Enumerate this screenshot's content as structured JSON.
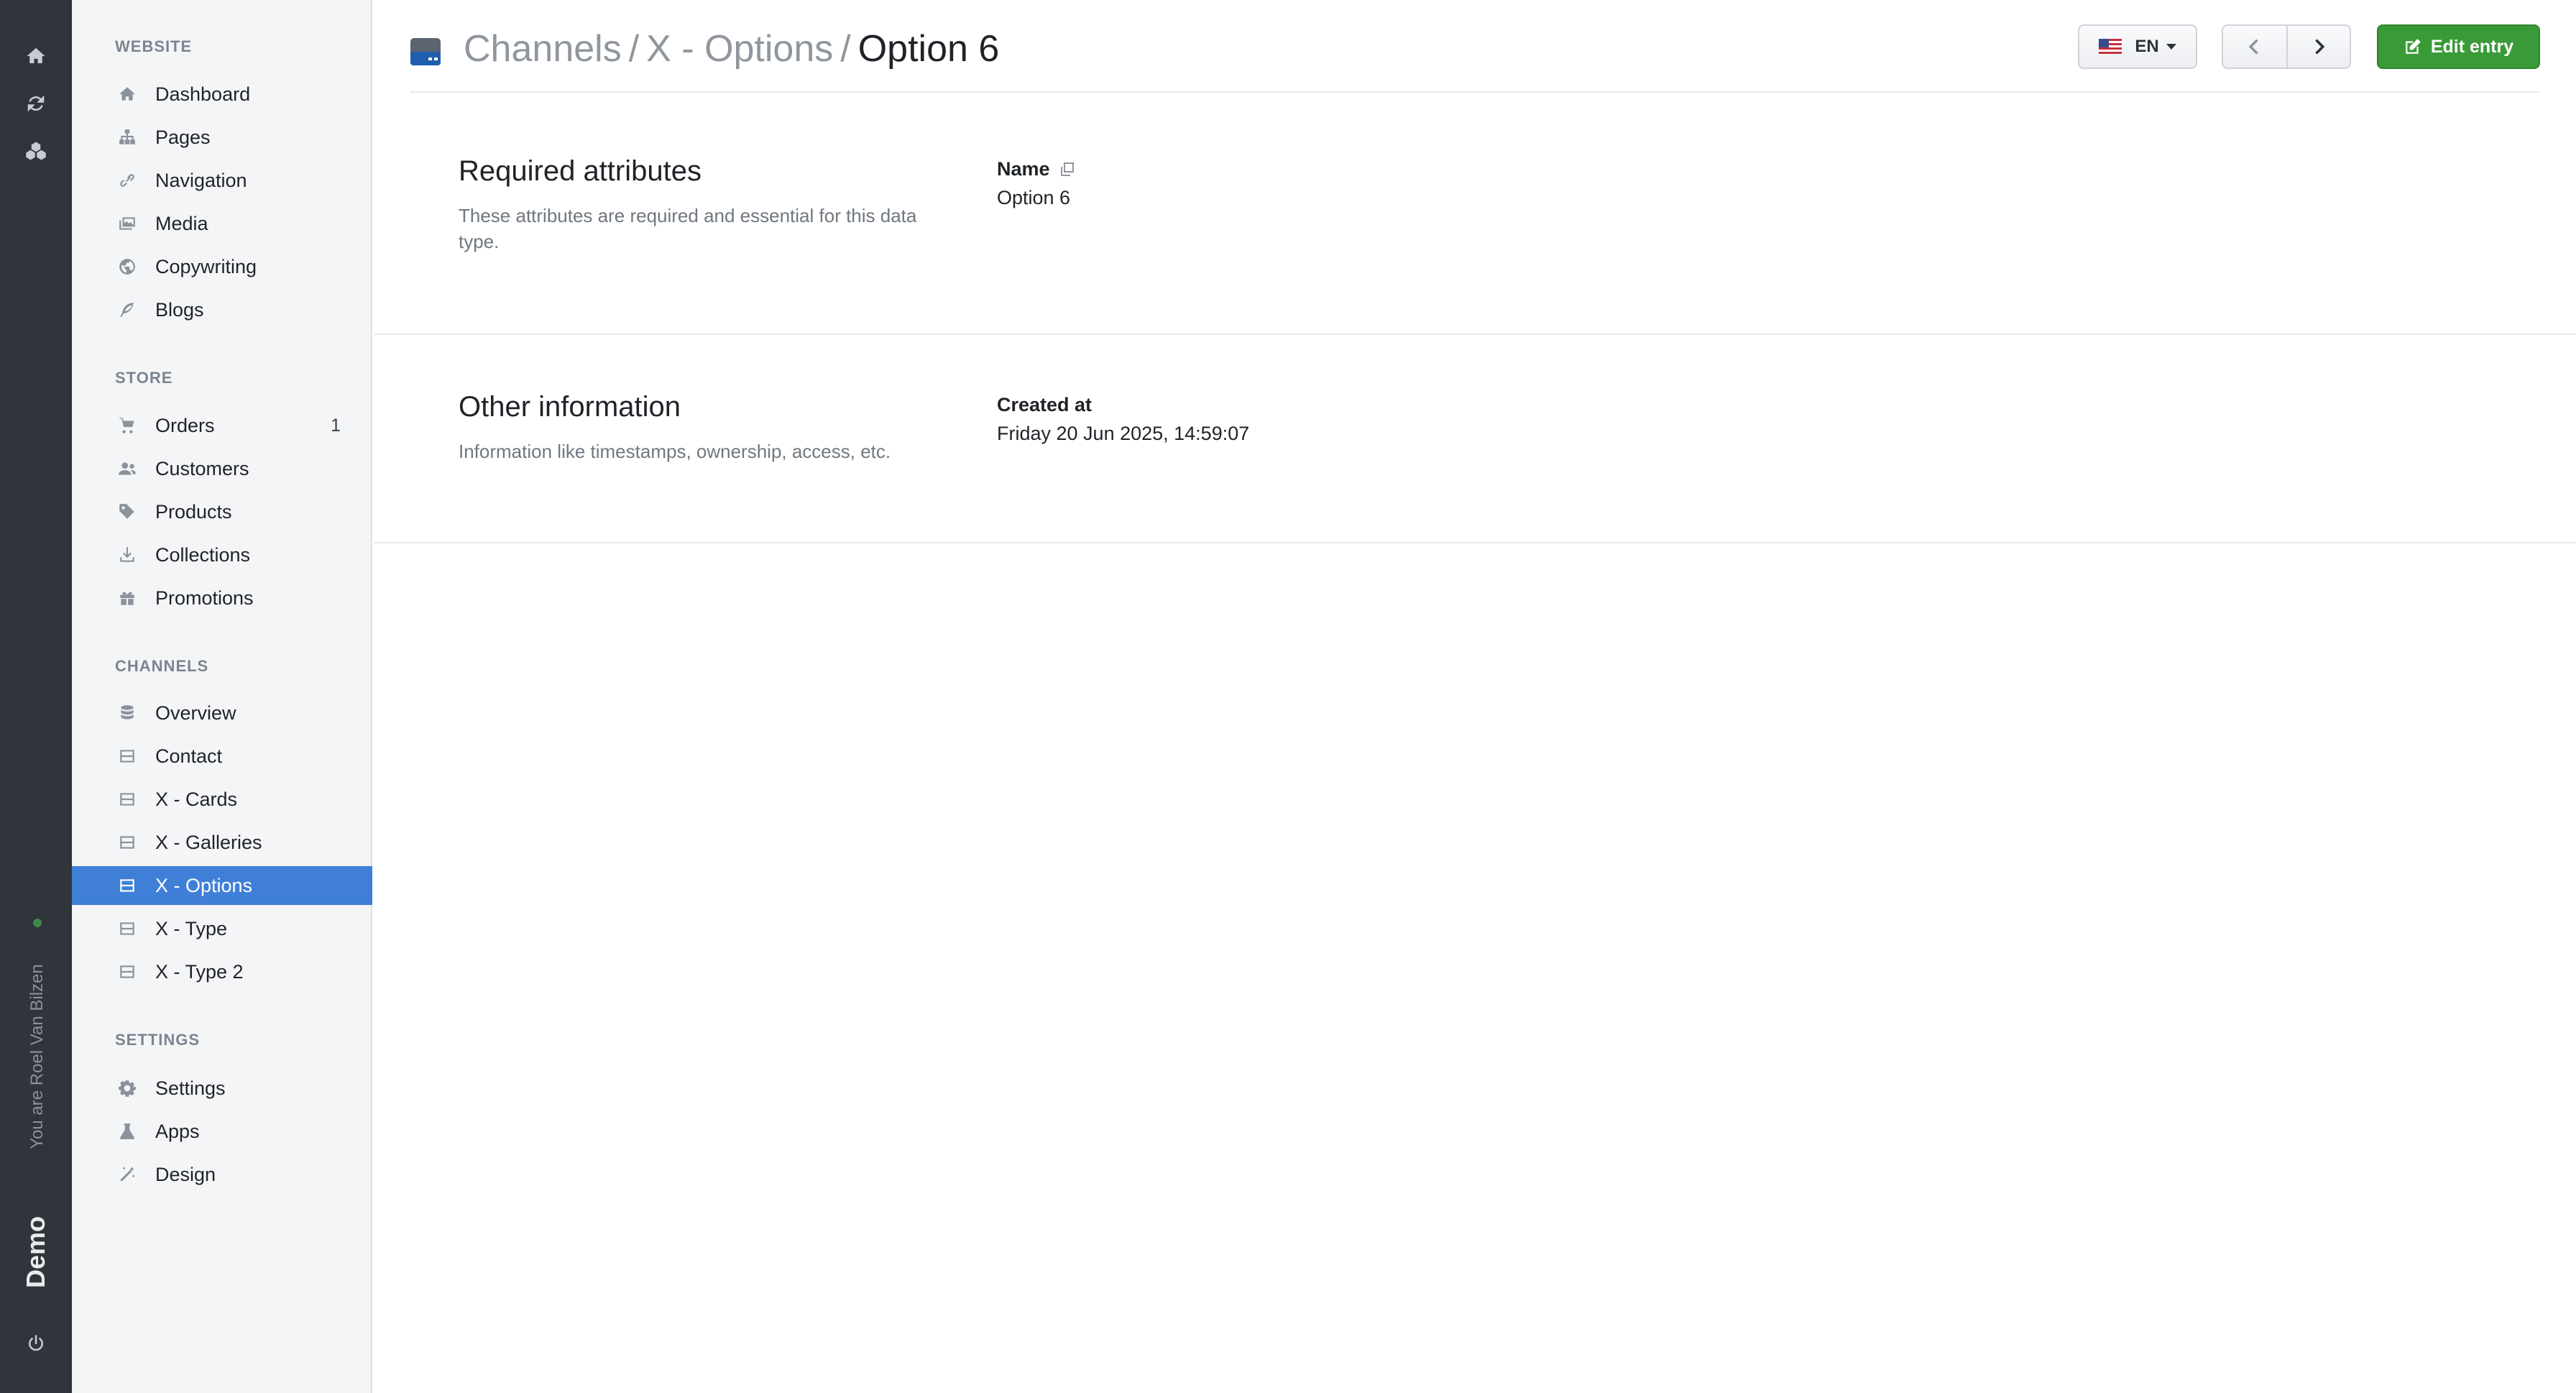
{
  "rail": {
    "icons": [
      "home-icon",
      "refresh-icon",
      "cubes-icon"
    ],
    "user_text": "You are Roel Van Bilzen",
    "brand": "Demo",
    "power_icon": "power-icon"
  },
  "sidebar": {
    "sections": [
      {
        "title": "WEBSITE",
        "items": [
          {
            "label": "Dashboard",
            "icon": "home-icon"
          },
          {
            "label": "Pages",
            "icon": "sitemap-icon"
          },
          {
            "label": "Navigation",
            "icon": "link-icon"
          },
          {
            "label": "Media",
            "icon": "images-icon"
          },
          {
            "label": "Copywriting",
            "icon": "globe-icon"
          },
          {
            "label": "Blogs",
            "icon": "feather-icon"
          }
        ]
      },
      {
        "title": "STORE",
        "items": [
          {
            "label": "Orders",
            "icon": "cart-icon",
            "count": "1"
          },
          {
            "label": "Customers",
            "icon": "users-icon"
          },
          {
            "label": "Products",
            "icon": "tag-icon"
          },
          {
            "label": "Collections",
            "icon": "download-icon"
          },
          {
            "label": "Promotions",
            "icon": "gift-icon"
          }
        ]
      },
      {
        "title": "CHANNELS",
        "items": [
          {
            "label": "Overview",
            "icon": "database-icon"
          },
          {
            "label": "Contact",
            "icon": "window-icon"
          },
          {
            "label": "X - Cards",
            "icon": "window-icon"
          },
          {
            "label": "X - Galleries",
            "icon": "window-icon"
          },
          {
            "label": "X - Options",
            "icon": "window-icon",
            "active": true
          },
          {
            "label": "X - Type",
            "icon": "window-icon"
          },
          {
            "label": "X - Type 2",
            "icon": "window-icon"
          }
        ]
      },
      {
        "title": "SETTINGS",
        "items": [
          {
            "label": "Settings",
            "icon": "gear-icon"
          },
          {
            "label": "Apps",
            "icon": "flask-icon"
          },
          {
            "label": "Design",
            "icon": "magic-icon"
          }
        ]
      }
    ]
  },
  "header": {
    "breadcrumb": [
      "Channels",
      "X - Options",
      "Option 6"
    ],
    "separator": "/",
    "language": "EN",
    "edit_label": "Edit entry"
  },
  "sections": {
    "required": {
      "title": "Required attributes",
      "description": "These attributes are required and essential for this data type.",
      "field_label": "Name",
      "field_value": "Option 6"
    },
    "other": {
      "title": "Other information",
      "description": "Information like timestamps, ownership, access, etc.",
      "field_label": "Created at",
      "field_value": "Friday 20 Jun 2025, 14:59:07"
    }
  }
}
